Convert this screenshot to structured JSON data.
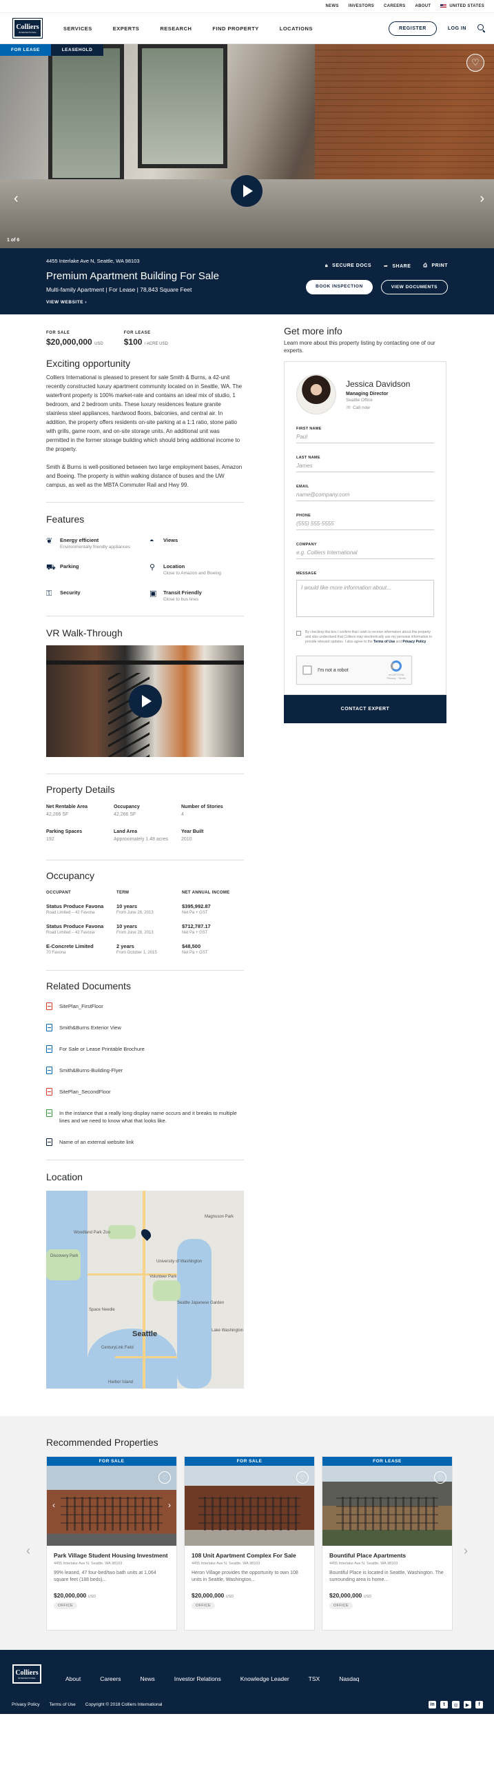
{
  "util_nav": {
    "news": "NEWS",
    "investors": "INVESTORS",
    "careers": "CAREERS",
    "about": "ABOUT",
    "region": "UNITED STATES"
  },
  "logo": {
    "name": "Colliers",
    "tagline": "INTERNATIONAL"
  },
  "nav": {
    "items": [
      "SERVICES",
      "EXPERTS",
      "RESEARCH",
      "FIND PROPERTY",
      "LOCATIONS"
    ],
    "register": "REGISTER",
    "login": "LOG IN"
  },
  "hero": {
    "tab_active": "FOR LEASE",
    "tab_inactive": "LEASEHOLD",
    "counter": "1 of 6",
    "heart": "♡",
    "prev": "‹",
    "next": "›"
  },
  "listing": {
    "address": "4455 Interlake Ave N, Seattle, WA 98103",
    "title": "Premium Apartment Building For Sale",
    "subtitle": "Multi-family Apartment | For Lease | 78,843 Square Feet",
    "website": "VIEW WEBSITE ›",
    "secure_docs": "SECURE DOCS",
    "share": "SHARE",
    "print": "PRINT",
    "book_inspection": "BOOK INSPECTION",
    "view_documents": "VIEW DOCUMENTS"
  },
  "prices": {
    "sale_label": "FOR SALE",
    "sale_value": "$20,000,000",
    "sale_unit": "USD",
    "lease_label": "FOR LEASE",
    "lease_value": "$100",
    "lease_unit": "/ ACRE USD"
  },
  "opportunity": {
    "heading": "Exciting opportunity",
    "p1": "Colliers International is pleased to present for sale Smith & Burns, a 42-unit recently constructed luxury apartment community located on in Seattle, WA. The waterfront property is 100% market-rate and contains an ideal mix of studio, 1 bedroom, and 2 bedroom units. These luxury residences feature granite stainless steel appliances, hardwood floors, balconies, and central air. In addition, the property offers residents on-site parking at a 1:1 ratio, stone patio with grills, game room, and on-site storage units. An additional unit was permitted in the former storage building which should bring additional income to the property.",
    "p2": "Smith & Burns is well-positioned between two large employment bases, Amazon and Boeing. The property is within walking distance of buses and the UW campus, as well as the MBTA Commuter Rail and Hwy 99."
  },
  "features": {
    "heading": "Features",
    "items": [
      {
        "title": "Energy efficient",
        "desc": "Environmentally friendly appliances",
        "icon": "leaf-icon",
        "glyph": "❦"
      },
      {
        "title": "Views",
        "desc": "",
        "icon": "landscape-icon",
        "glyph": "◓"
      },
      {
        "title": "Parking",
        "desc": "",
        "icon": "car-icon",
        "glyph": "⛟"
      },
      {
        "title": "Location",
        "desc": "Close to Amazon and Boeing",
        "icon": "location-pin-icon",
        "glyph": "⚲"
      },
      {
        "title": "Security",
        "desc": "",
        "icon": "lock-icon",
        "glyph": "⚿"
      },
      {
        "title": "Transit Friendly",
        "desc": "Close to bus lines",
        "icon": "bus-icon",
        "glyph": "▣"
      }
    ]
  },
  "vr": {
    "heading": "VR Walk-Through"
  },
  "details": {
    "heading": "Property Details",
    "items": [
      {
        "label": "Net Rentable Area",
        "value": "42,266 SF"
      },
      {
        "label": "Occupancy",
        "value": "42,266 SF"
      },
      {
        "label": "Number of Stories",
        "value": "4"
      },
      {
        "label": "Parking Spaces",
        "value": "192"
      },
      {
        "label": "Land Area",
        "value": "Approximately 1.48 acres"
      },
      {
        "label": "Year Built",
        "value": "2010"
      }
    ]
  },
  "occupancy": {
    "heading": "Occupancy",
    "col_occupant": "OCCUPANT",
    "col_term": "TERM",
    "col_income": "NET ANNUAL INCOME",
    "rows": [
      {
        "name": "Status Produce Favona",
        "name_sub": "Road Limited – 42 Favona",
        "term": "10 years",
        "term_sub": "From June 28, 2013",
        "income": "$395,992.87",
        "income_sub": "Net Pa + GST"
      },
      {
        "name": "Status Produce Favona",
        "name_sub": "Road Limited – 42 Favona",
        "term": "10 years",
        "term_sub": "From June 28, 2013",
        "income": "$712,787.17",
        "income_sub": "Net Pa + GST"
      },
      {
        "name": "E-Concrete Limited",
        "name_sub": "70 Favona",
        "term": "2 years",
        "term_sub": "From October 1, 2015",
        "income": "$48,500",
        "income_sub": "Net Pa + GST"
      }
    ]
  },
  "documents": {
    "heading": "Related Documents",
    "items": [
      {
        "label": "SitePlan_FirstFloor",
        "color": "red",
        "icon": "pdf-icon"
      },
      {
        "label": "Smith&Burns Exterior View",
        "color": "blue",
        "icon": "image-file-icon"
      },
      {
        "label": "For Sale or Lease Printable Brochure",
        "color": "blue",
        "icon": "document-icon"
      },
      {
        "label": "Smith&Burns-Building-Flyer",
        "color": "blue",
        "icon": "document-icon"
      },
      {
        "label": "SitePlan_SecondFloor",
        "color": "red",
        "icon": "pdf-icon"
      },
      {
        "label": "In the instance that a really long display name occurs and it breaks to multiple lines and we need to know what that looks like.",
        "color": "green",
        "icon": "spreadsheet-icon"
      },
      {
        "label": "Name of an external website link",
        "color": "navy",
        "icon": "external-link-icon"
      }
    ]
  },
  "location": {
    "heading": "Location",
    "map_labels": {
      "zoo": "Woodland Park Zoo",
      "discovery": "Discovery Park",
      "university": "University of Washington",
      "volunteer": "Volunteer Park",
      "needle": "Space Needle",
      "garden": "Seattle Japanese Garden",
      "magnuson": "Magnuson Park",
      "lake": "Lake Washington",
      "city": "Seattle",
      "harbor": "Harbor Island",
      "century": "CenturyLink Field"
    }
  },
  "contact": {
    "heading": "Get more info",
    "intro": "Learn more about this property listing by contacting one of our experts.",
    "agent_name": "Jessica Davidson",
    "agent_title": "Managing Director",
    "agent_office": "Seattle Office",
    "agent_call": "Call now",
    "first_name_label": "FIRST NAME",
    "first_name_ph": "Paul",
    "last_name_label": "LAST NAME",
    "last_name_ph": "James",
    "email_label": "EMAIL",
    "email_ph": "name@company.com",
    "phone_label": "PHONE",
    "phone_ph": "(555) 555-5555",
    "company_label": "COMPANY",
    "company_ph": "e.g. Colliers International",
    "message_label": "MESSAGE",
    "message_ph": "I would like more information about...",
    "consent_1": "By checking this box I confirm that I wish to receive information about this property and also understand that Colliers may electronically use my personal information to provide relevant updates. I also agree to the ",
    "consent_terms": "Terms of Use",
    "consent_and": " and ",
    "consent_privacy": "Privacy Policy",
    "captcha_label": "I'm not a robot",
    "captcha_brand": "reCAPTCHA",
    "captcha_links": "Privacy - Terms",
    "submit": "CONTACT EXPERT"
  },
  "recommended": {
    "heading": "Recommended Properties",
    "cards": [
      {
        "badge": "FOR SALE",
        "title": "Park Village Student Housing Investment",
        "address": "4455 Interlake Ave N, Seattle, WA 98103",
        "desc": "99% leased, 47 four-bed/two bath units at 1,064 square feet (188 beds)...",
        "price": "$20,000,000",
        "unit": "USD",
        "tag": "OFFICE"
      },
      {
        "badge": "FOR SALE",
        "title": "108 Unit Apartment Complex For Sale",
        "address": "4455 Interlake Ave N, Seattle, WA 98103",
        "desc": "Heron Village provides the opportunity to own 108 units in Seattle, Washington...",
        "price": "$20,000,000",
        "unit": "USD",
        "tag": "OFFICE"
      },
      {
        "badge": "FOR LEASE",
        "title": "Bountiful Place Apartments",
        "address": "4455 Interlake Ave N, Seattle, WA 98103",
        "desc": "Bountiful Place is located in Seattle, Washington. The surrounding area is home...",
        "price": "$20,000,000",
        "unit": "USD",
        "tag": "OFFICE"
      }
    ]
  },
  "footer": {
    "links": [
      "About",
      "Careers",
      "News",
      "Investor Relations",
      "Knowledge Leader",
      "TSX",
      "Nasdaq"
    ],
    "privacy": "Privacy Policy",
    "terms": "Terms of Use",
    "copyright": "Copyright © 2018 Colliers International",
    "social": {
      "linkedin": "in",
      "twitter": "t",
      "instagram": "◎",
      "youtube": "▶",
      "facebook": "f"
    }
  }
}
